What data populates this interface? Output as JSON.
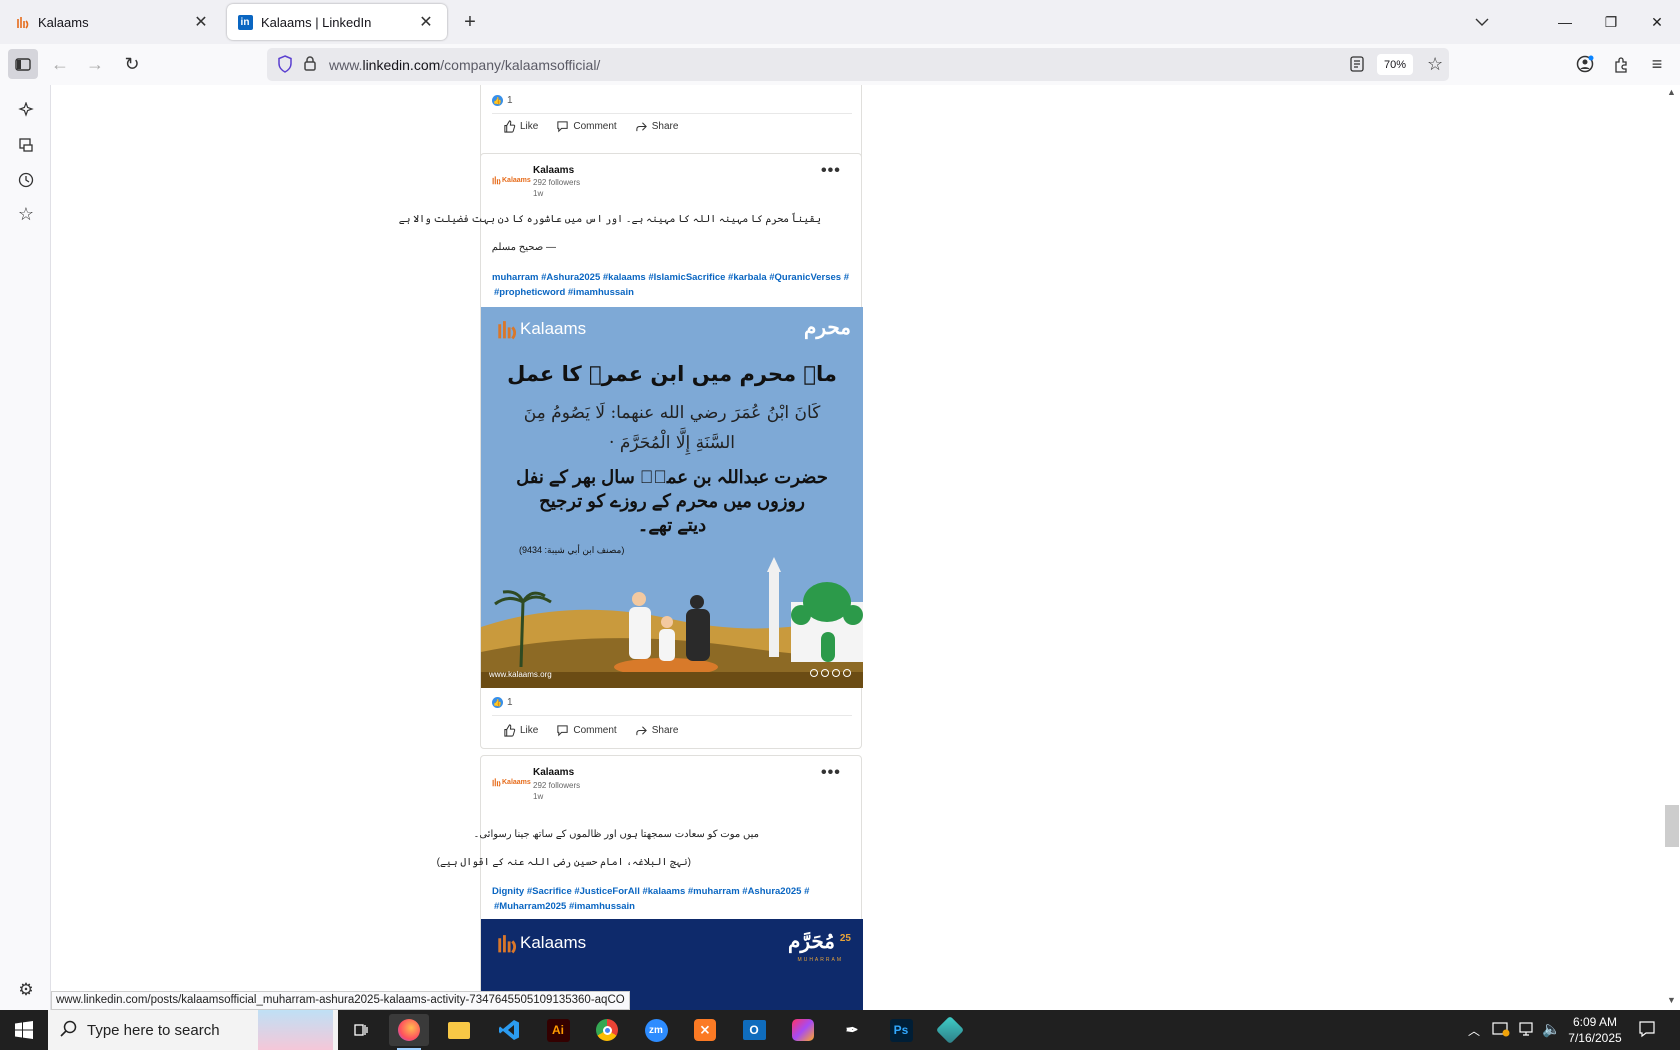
{
  "browser": {
    "tabs": [
      {
        "title": "Kalaams",
        "active": false,
        "icon": "kalaams-favicon"
      },
      {
        "title": "Kalaams | LinkedIn",
        "active": true,
        "icon": "linkedin-favicon"
      }
    ],
    "url_prefix": "www.",
    "url_domain": "linkedin.com",
    "url_path": "/company/kalaamsofficial/",
    "zoom": "70%",
    "status_url": "www.linkedin.com/posts/kalaamsofficial_muharram-ashura2025-kalaams-activity-7347645505109135360-aqCO"
  },
  "feed": {
    "prev_post": {
      "reaction_count": "1",
      "actions": {
        "like": "Like",
        "comment": "Comment",
        "share": "Share"
      }
    },
    "post1": {
      "company": "Kalaams",
      "logo_text": "Kalaams",
      "followers": "292 followers",
      "time": "1w",
      "line1": "یقیناً محرم کا مہینہ اللہ کا مہینہ ہے۔ اور اس میں عاشورہ کا دن بہت فضیلت والا ہے",
      "line2": "— صحیح مسلم",
      "tags_line1": "muharram #Ashura2025 #kalaams #IslamicSacrifice #karbala #QuranicVerses #",
      "tags_line2": "#propheticword #imamhussain",
      "image": {
        "brand": "Kalaams",
        "badge": "محرم",
        "title": "ماہ محرم میں ابن عمرؓ کا عمل",
        "arabic_1": "كَانَ ابْنُ عُمَرَ رضي الله عنهما: لَا يَصُومُ مِنَ",
        "arabic_2": "السَّنَةِ إِلَّا الْمُحَرَّمَ ·",
        "urdu_1": "حضرت عبداللہ بن عمرؓ سال بھر کے نفل",
        "urdu_2": "روزوں میں محرم کے روزے کو ترجیح",
        "urdu_3": "دیتے تھے۔",
        "reference": "(مصنف ابن أبي شيبة: 9434)",
        "website": "www.kalaams.org"
      },
      "reaction_count": "1",
      "actions": {
        "like": "Like",
        "comment": "Comment",
        "share": "Share"
      }
    },
    "post2": {
      "company": "Kalaams",
      "logo_text": "Kalaams",
      "followers": "292 followers",
      "time": "1w",
      "line1": "میں موت کو سعادت سمجھتا ہوں اور ظالموں کے ساتھ جینا رسوائی۔",
      "line2": "(نہج البلاغہ، امام حسین رضی اللہ عنہ کے اقوال ہیے)",
      "tags_line1": "Dignity #Sacrifice #JusticeForAll #kalaams #muharram #Ashura2025 #",
      "tags_line2": "#Muharram2025 #imamhussain",
      "image": {
        "brand": "Kalaams",
        "badge": "مُحَرَّم",
        "badge_num": "25",
        "badge_sub": "MUHARRAM"
      }
    }
  },
  "taskbar": {
    "search_placeholder": "Type here to search",
    "time": "6:09 AM",
    "date": "7/16/2025",
    "apps": [
      "firefox-icon",
      "file-explorer-icon",
      "vscode-icon",
      "illustrator-icon",
      "chrome-icon",
      "zoom-icon",
      "xampp-icon",
      "outlook-icon",
      "creative-cloud-icon",
      "pen-tool-icon",
      "photoshop-icon",
      "app-icon"
    ]
  }
}
